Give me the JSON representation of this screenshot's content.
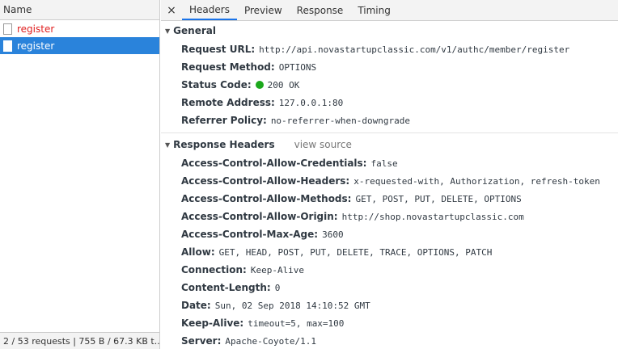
{
  "left": {
    "name_header": "Name",
    "requests": [
      {
        "label": "register",
        "state": "error"
      },
      {
        "label": "register",
        "state": "selected"
      }
    ],
    "status_bar": "2 / 53 requests | 755 B / 67.3 KB t..."
  },
  "tabs": {
    "close": "×",
    "items": [
      "Headers",
      "Preview",
      "Response",
      "Timing"
    ],
    "active": "Headers"
  },
  "general": {
    "title": "General",
    "rows": [
      {
        "key": "Request URL:",
        "value": "http://api.novastartupclassic.com/v1/authc/member/register"
      },
      {
        "key": "Request Method:",
        "value": "OPTIONS"
      },
      {
        "key": "Status Code:",
        "value": "200 OK"
      },
      {
        "key": "Remote Address:",
        "value": "127.0.0.1:80"
      },
      {
        "key": "Referrer Policy:",
        "value": "no-referrer-when-downgrade"
      }
    ]
  },
  "response_headers": {
    "title": "Response Headers",
    "view_source": "view source",
    "rows": [
      {
        "key": "Access-Control-Allow-Credentials:",
        "value": "false"
      },
      {
        "key": "Access-Control-Allow-Headers:",
        "value": "x-requested-with, Authorization, refresh-token"
      },
      {
        "key": "Access-Control-Allow-Methods:",
        "value": "GET, POST, PUT, DELETE, OPTIONS"
      },
      {
        "key": "Access-Control-Allow-Origin:",
        "value": "http://shop.novastartupclassic.com"
      },
      {
        "key": "Access-Control-Max-Age:",
        "value": "3600"
      },
      {
        "key": "Allow:",
        "value": "GET, HEAD, POST, PUT, DELETE, TRACE, OPTIONS, PATCH"
      },
      {
        "key": "Connection:",
        "value": "Keep-Alive"
      },
      {
        "key": "Content-Length:",
        "value": "0"
      },
      {
        "key": "Date:",
        "value": "Sun, 02 Sep 2018 14:10:52 GMT"
      },
      {
        "key": "Keep-Alive:",
        "value": "timeout=5, max=100"
      },
      {
        "key": "Server:",
        "value": "Apache-Coyote/1.1"
      }
    ]
  },
  "colors": {
    "accent": "#1a73e8",
    "selected_row": "#2a83db",
    "error_text": "#e02020",
    "status_ok": "#1ca81c"
  }
}
